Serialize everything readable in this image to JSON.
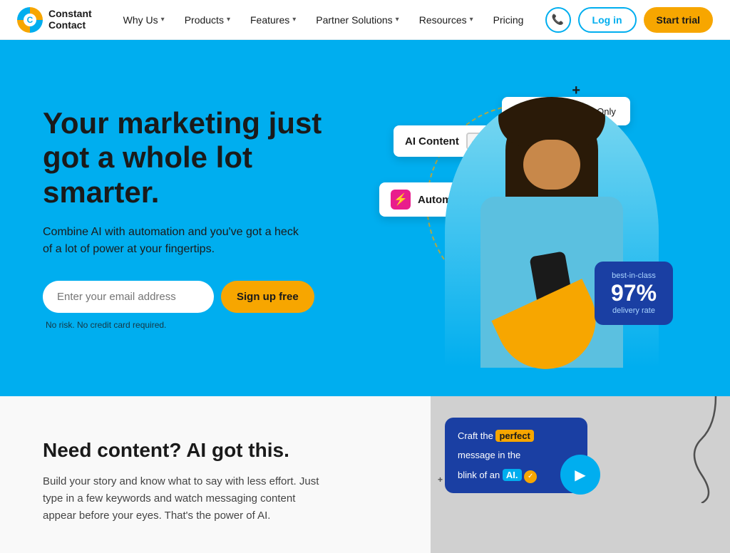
{
  "nav": {
    "logo": {
      "line1": "Constant",
      "line2": "Contact"
    },
    "links": [
      {
        "label": "Why Us",
        "hasDropdown": true
      },
      {
        "label": "Products",
        "hasDropdown": true
      },
      {
        "label": "Features",
        "hasDropdown": true
      },
      {
        "label": "Partner Solutions",
        "hasDropdown": true
      },
      {
        "label": "Resources",
        "hasDropdown": true
      },
      {
        "label": "Pricing",
        "hasDropdown": false
      }
    ],
    "phone_label": "📞",
    "login_label": "Log in",
    "trial_label": "Start trial"
  },
  "hero": {
    "title": "Your marketing just got a whole lot smarter.",
    "subtitle": "Combine AI with automation and you've got a heck of a lot of power at your fingertips.",
    "email_placeholder": "Enter your email address",
    "signup_label": "Sign up free",
    "no_risk": "No risk. No credit card required.",
    "ai_badge": "AI Content",
    "automation_badge": "Automation Tools",
    "email_card": "Big Sale, Today Only",
    "delivery_rate": "97%",
    "delivery_label_top": "best-in-class",
    "delivery_label_bot": "delivery rate"
  },
  "lower": {
    "title": "Need content? AI got this.",
    "text": "Build your story and know what to say with less effort. Just type in a few keywords and watch messaging content appear before your eyes. That's the power of AI.",
    "craft_line1": "Craft the",
    "craft_keyword1": "perfect",
    "craft_line2": "message",
    "craft_line2b": "in the",
    "craft_line3": "blink of an",
    "craft_keyword2": "AI."
  }
}
